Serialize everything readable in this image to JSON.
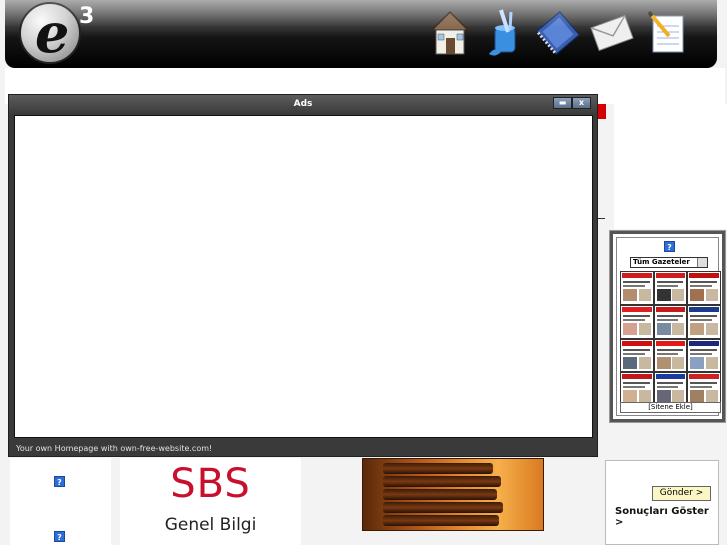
{
  "header": {
    "logo_letter": "e",
    "logo_sup": "3",
    "nav": [
      {
        "icon": "home-icon"
      },
      {
        "icon": "paint-brush-icon"
      },
      {
        "icon": "notebook-icon"
      },
      {
        "icon": "envelope-icon"
      },
      {
        "icon": "notepad-pencil-icon"
      }
    ]
  },
  "modal": {
    "title": "Ads",
    "minimize_label": "▬",
    "close_label": "x",
    "footer": "Your own Homepage with own-free-website.com!"
  },
  "news_widget": {
    "select_label": "Tüm Gazeteler",
    "footer": "[Sitene Ekle]",
    "help_icon": "?"
  },
  "sbs": {
    "title": "SBS",
    "subtitle": "Genel Bilgi"
  },
  "poll": {
    "send_label": "Gönder >",
    "results_label": "Sonuçları Göster >"
  },
  "help_icon": "?",
  "colors": {
    "accent_red": "#d40000",
    "sbs_red": "#c8102e",
    "send_bg": "#fbf7c4"
  }
}
